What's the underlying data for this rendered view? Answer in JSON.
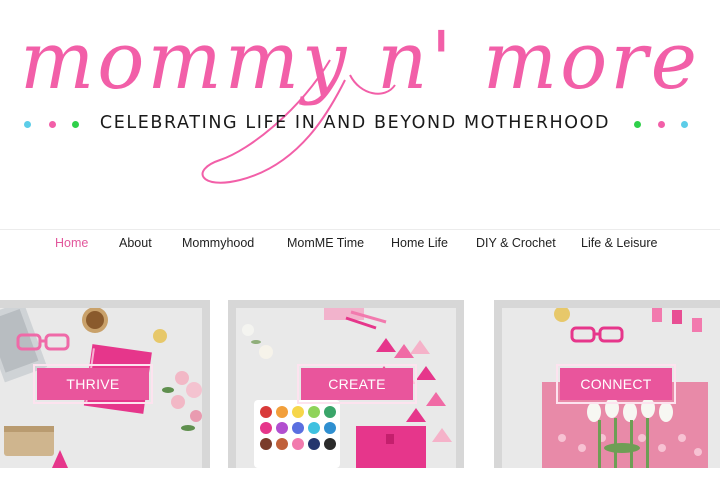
{
  "site": {
    "logo_text": "mommy n' more",
    "tagline": "CELEBRATING LIFE IN AND BEYOND MOTHERHOOD",
    "dot_colors": [
      "#5ccde8",
      "#f25fa8",
      "#2fd04a"
    ]
  },
  "nav": {
    "items": [
      {
        "label": "Home",
        "active": true
      },
      {
        "label": "About"
      },
      {
        "label": "Mommyhood"
      },
      {
        "label": "MomME Time"
      },
      {
        "label": "Home Life"
      },
      {
        "label": "DIY & Crochet"
      },
      {
        "label": "Life & Leisure"
      }
    ]
  },
  "tiles": [
    {
      "label": "THRIVE"
    },
    {
      "label": "CREATE"
    },
    {
      "label": "CONNECT"
    }
  ],
  "colors": {
    "brand_pink": "#f25fa8",
    "button_pink": "#e9559c",
    "nav_active": "#e2579c"
  }
}
